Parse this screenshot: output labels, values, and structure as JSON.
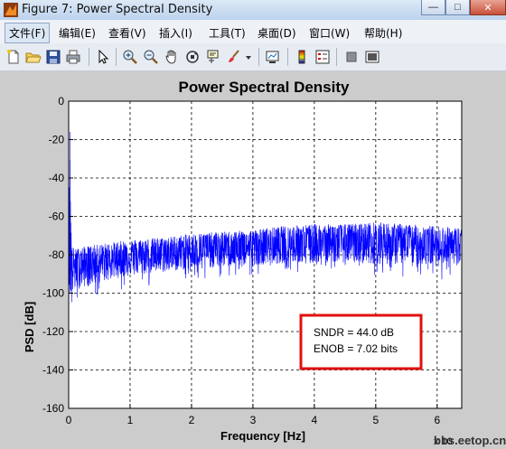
{
  "window": {
    "title": "Figure 7: Power Spectral Density",
    "minimize_glyph": "—",
    "maximize_glyph": "□",
    "close_glyph": "✕"
  },
  "menu": [
    {
      "label": "文件(F)"
    },
    {
      "label": "编辑(E)"
    },
    {
      "label": "查看(V)"
    },
    {
      "label": "插入(I)"
    },
    {
      "label": "工具(T)"
    },
    {
      "label": "桌面(D)"
    },
    {
      "label": "窗口(W)"
    },
    {
      "label": "帮助(H)"
    }
  ],
  "toolbar": {
    "icons": [
      "new-figure-icon",
      "open-file-icon",
      "save-icon",
      "print-icon",
      "edit-plot-arrow-icon",
      "zoom-in-icon",
      "zoom-out-icon",
      "pan-hand-icon",
      "rotate-3d-icon",
      "data-cursor-icon",
      "brush-icon",
      "brush-dropdown-icon",
      "link-plot-icon",
      "colorbar-icon",
      "legend-icon",
      "hide-plot-tools-icon",
      "show-plot-tools-icon"
    ]
  },
  "chart_data": {
    "type": "line",
    "title": "Power Spectral Density",
    "xlabel": "Frequency [Hz]",
    "ylabel": "PSD [dB]",
    "xlim": [
      0,
      6.4
    ],
    "ylim": [
      -160,
      0
    ],
    "x_ticks": [
      "0",
      "1",
      "2",
      "3",
      "4",
      "5",
      "6"
    ],
    "y_ticks": [
      "0",
      "-20",
      "-40",
      "-60",
      "-80",
      "-100",
      "-120",
      "-140",
      "-160"
    ],
    "x_exponent_label": "x 10",
    "grid": true,
    "line_color": "#0000ff",
    "series": [
      {
        "x": [
          0,
          0.02,
          0.05,
          0.1,
          0.2,
          0.4,
          0.6,
          0.8,
          1.0,
          1.5,
          2.0,
          2.5,
          3.0,
          3.5,
          4.0,
          4.5,
          5.0,
          5.5,
          6.0,
          6.4
        ],
        "upper": [
          -62,
          -16,
          -75,
          -77,
          -76,
          -75,
          -74,
          -73,
          -72,
          -71,
          -69,
          -68,
          -67,
          -65,
          -64,
          -64,
          -63,
          -64,
          -65,
          -66
        ],
        "lower": [
          -100,
          -110,
          -106,
          -104,
          -102,
          -100,
          -98,
          -96,
          -95,
          -93,
          -91,
          -90,
          -89,
          -88,
          -88,
          -88,
          -89,
          -89,
          -90,
          -92
        ],
        "center": [
          -84,
          -82,
          -88,
          -87,
          -86,
          -85,
          -84,
          -83,
          -82,
          -81,
          -79,
          -78,
          -77,
          -76,
          -75,
          -75,
          -75,
          -75,
          -76,
          -77
        ]
      }
    ],
    "annotation": {
      "lines": [
        "SNDR = 44.0 dB",
        "ENOB = 7.02 bits"
      ],
      "border_color": "#e01010"
    }
  },
  "watermark": "bbs.eetop.cn"
}
